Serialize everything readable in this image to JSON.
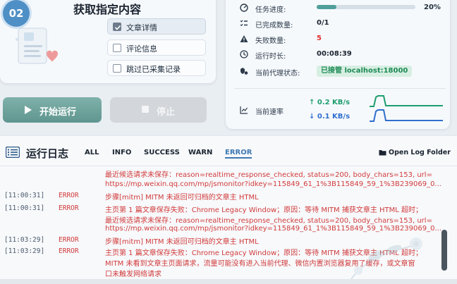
{
  "select_section": {
    "step_number": "02",
    "title": "获取指定内容",
    "options": [
      {
        "label": "文章详情",
        "checked": true
      },
      {
        "label": "评论信息",
        "checked": false
      },
      {
        "label": "跳过已采集记录",
        "checked": false
      }
    ]
  },
  "actions": {
    "start_label": "开始运行",
    "stop_label": "停止"
  },
  "status": {
    "progress_label": "任务进度:",
    "progress_value": "20%",
    "progress_fraction": 0.2,
    "completed_label": "已完成数量:",
    "completed_value": "0/1",
    "failed_label": "失败数量:",
    "failed_value": "5",
    "runtime_label": "运行时长:",
    "runtime_value": "00:08:39",
    "proxy_label": "当前代理状态:",
    "proxy_value": "已接管 localhost:18000",
    "speed_label": "当前速率",
    "upload_speed": "↑ 0.2 KB/s",
    "download_speed": "↓ 0.1 KB/s",
    "colors": {
      "accent": "#4f9e9a",
      "failed": "#e03131",
      "upload": "#1e9e6e",
      "download": "#2f6fcf"
    }
  },
  "log": {
    "title": "运行日志",
    "tabs": [
      "ALL",
      "INFO",
      "SUCCESS",
      "WARN",
      "ERROR"
    ],
    "active_tab": "ERROR",
    "open_folder_label": "Open Log Folder",
    "lines": [
      {
        "time": "",
        "level": "",
        "text": "最近候选请求未保存：reason=realtime_response_checked, status=200, body_chars=153, url="
      },
      {
        "time": "",
        "level": "",
        "text": "https://mp.weixin.qq.com/mp/jsmonitor?idkey=115849_61_1%3B115849_59_1%3B239069_0..."
      },
      {
        "time": "[11:00:31]",
        "level": "ERROR",
        "text": "步骤[mitm] MITM 未返回可归档的文章主 HTML"
      },
      {
        "time": "[11:00:31]",
        "level": "ERROR",
        "text": "主页第 1 篇文章保存失败：Chrome Legacy Window；原因：等待 MITM 捕获文章主 HTML 超时；"
      },
      {
        "time": "",
        "level": "",
        "text": "最近候选请求未保存：reason=realtime_response_checked, status=200, body_chars=153, url="
      },
      {
        "time": "",
        "level": "",
        "text": "https://mp.weixin.qq.com/mp/jsmonitor?idkey=115849_61_1%3B115849_59_1%3B239069_0..."
      },
      {
        "time": "[11:03:29]",
        "level": "ERROR",
        "text": "步骤[mitm] MITM 未返回可归档的文章主 HTML"
      },
      {
        "time": "[11:03:29]",
        "level": "ERROR",
        "text": "主页第 1 篇文章保存失败：Chrome Legacy Window；原因：等待 MITM 捕获文章主 HTML 超时；"
      },
      {
        "time": "",
        "level": "",
        "text": "MITM 未看到文章主页面请求，流量可能没有进入当前代理、微信内置浏览器复用了缓存，或文章窗"
      },
      {
        "time": "",
        "level": "",
        "text": "口未触发网络请求"
      }
    ]
  }
}
